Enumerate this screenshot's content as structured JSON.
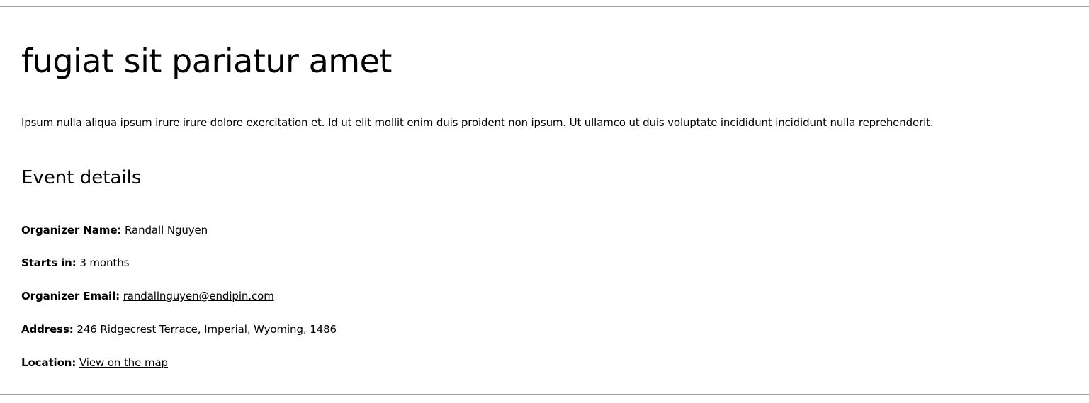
{
  "page": {
    "title": "fugiat sit pariatur amet",
    "intro": "Ipsum nulla aliqua ipsum irure irure dolore exercitation et. Id ut elit mollit enim duis proident non ipsum. Ut ullamco ut duis voluptate incididunt incididunt nulla reprehenderit."
  },
  "event_details": {
    "heading": "Event details",
    "organizer_name": {
      "label": "Organizer Name:",
      "value": "Randall Nguyen"
    },
    "starts_in": {
      "label": "Starts in:",
      "value": "3 months"
    },
    "organizer_email": {
      "label": "Organizer Email:",
      "value": "randallnguyen@endipin.com"
    },
    "address": {
      "label": "Address:",
      "value": "246 Ridgecrest Terrace, Imperial, Wyoming, 1486"
    },
    "location": {
      "label": "Location:",
      "link_text": "View on the map"
    }
  },
  "colors": {
    "text": "#000000",
    "background": "#ffffff",
    "rule": "#a0a0a0"
  }
}
